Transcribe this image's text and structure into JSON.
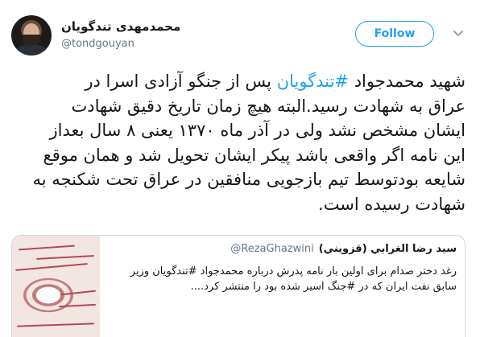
{
  "author": {
    "display_name": "محمدمهدی تندگویان",
    "handle": "@tondgouyan"
  },
  "follow_label": "Follow",
  "icons": {
    "avatar": "profile-photo",
    "menu": "chevron-down-icon"
  },
  "tweet": {
    "line1_before": "شهید محمدجواد ",
    "hashtag": "#تندگویان",
    "line1_after": " پس از جنگو آزادی اسرا در",
    "body_rest": "عراق به شهادت رسید.البته هیچ زمان تاریخ دقیق شهادت\nایشان مشخص نشد ولی در آذر ماه ۱۳۷۰ یعنی ۸ سال بعداز\nاین نامه اگر واقعی باشد پیکر ایشان تحویل شد و همان موقع\nشایعه بودتوسط تیم بازجویی منافقین در عراق تحت شکنجه به\nشهادت رسیده است."
  },
  "quoted_tweet": {
    "display_name": "سید رضا الغرابي (قزويني)",
    "handle": "@RezaGhazwini",
    "text": "رغد دختر صدام برای اولین بار نامه پدرش درباره محمدجواد #تندگویان وزیر سابق نفت ایران که در #جنگ اسیر شده بود را منتشر کرد...."
  },
  "colors": {
    "link": "#1da1f2",
    "secondary_text": "#657786",
    "border": "#ccd6dd"
  }
}
